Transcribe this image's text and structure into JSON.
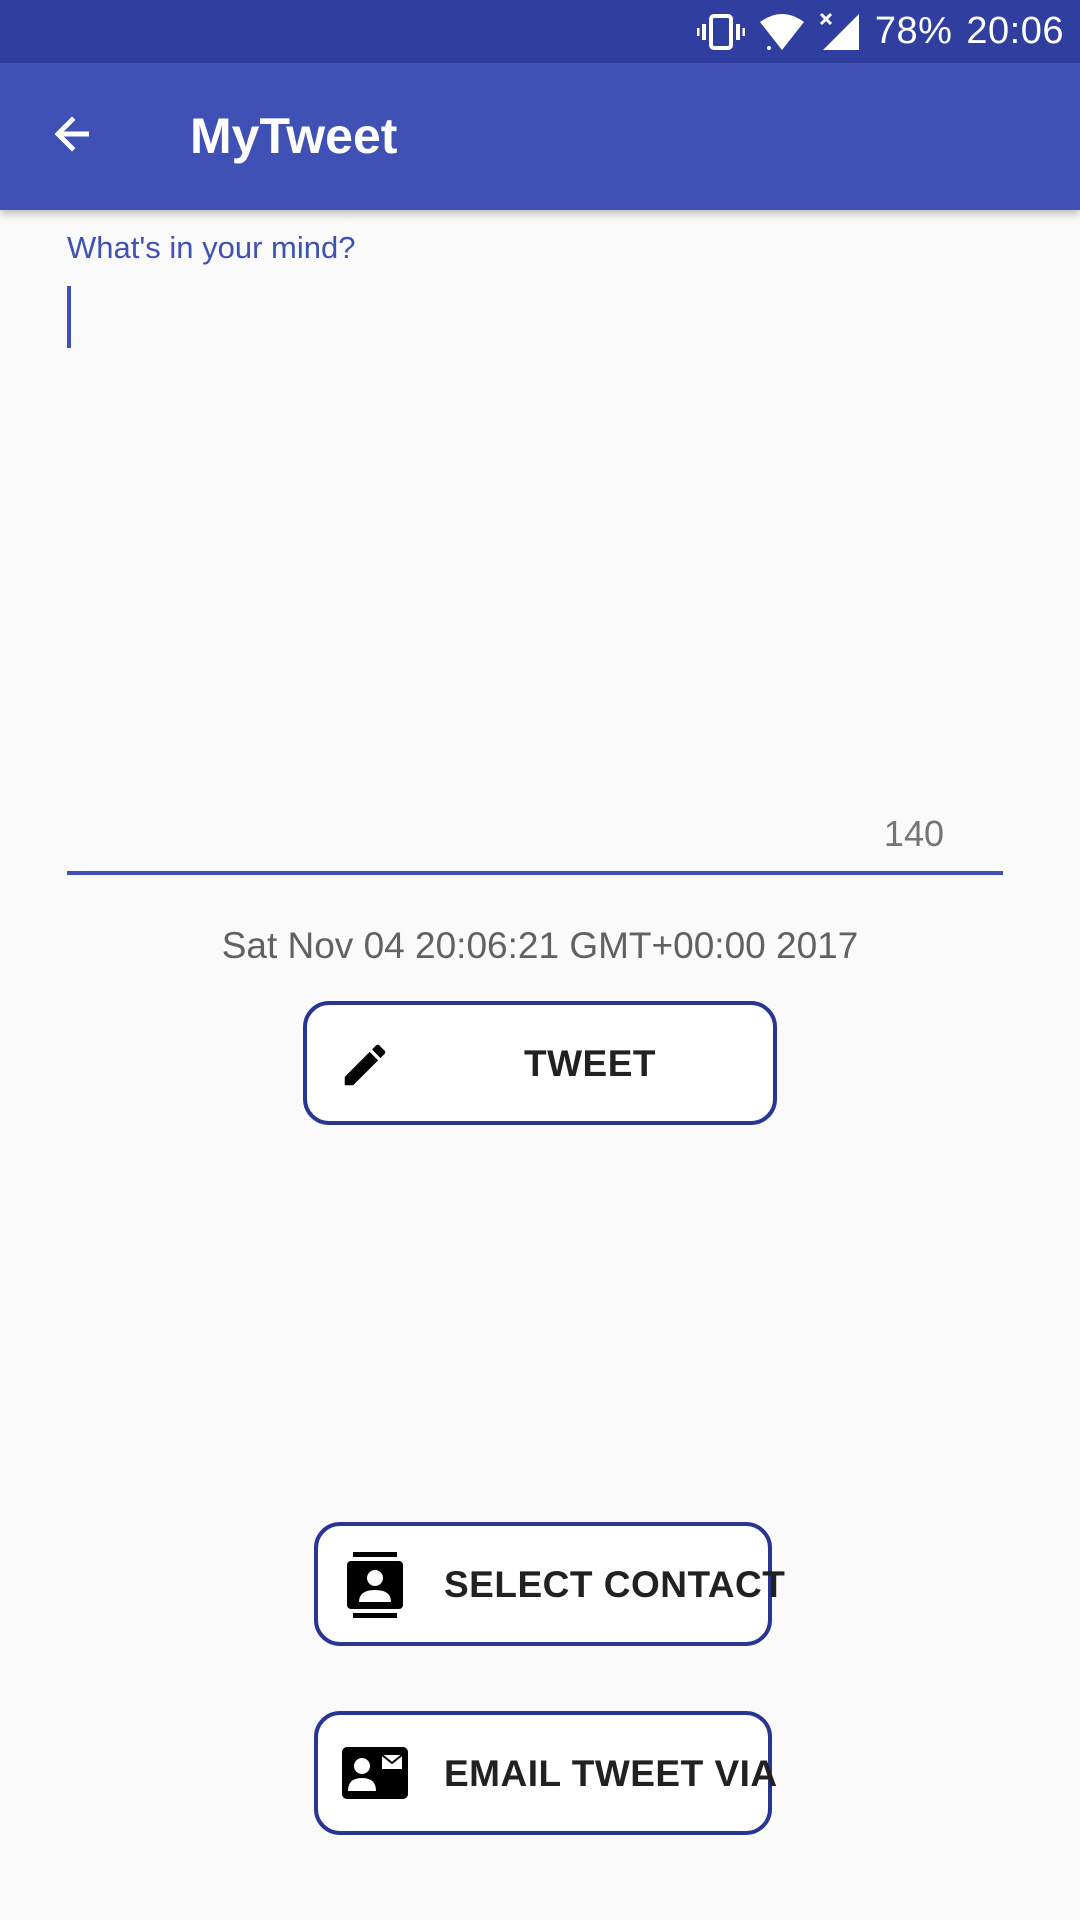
{
  "status_bar": {
    "battery": "78%",
    "time": "20:06",
    "icons": [
      "vibrate-icon",
      "wifi-icon",
      "cell-signal-icon"
    ]
  },
  "app_bar": {
    "title": "MyTweet",
    "back_icon": "arrow-back-icon"
  },
  "tweet_field": {
    "label": "What's in your mind?",
    "value": "",
    "counter": "140"
  },
  "timestamp": "Sat Nov 04 20:06:21 GMT+00:00 2017",
  "buttons": {
    "tweet": {
      "label": "TWEET",
      "icon": "pencil-icon"
    },
    "select_contact": {
      "label": "SELECT CONTACT",
      "icon": "contact-icon"
    },
    "email": {
      "label": "EMAIL TWEET VIA",
      "icon": "contact-mail-icon"
    }
  },
  "colors": {
    "primary": "#3f51b5",
    "primary_dark": "#303f9f",
    "button_border": "#283593",
    "background": "#fafafa"
  }
}
